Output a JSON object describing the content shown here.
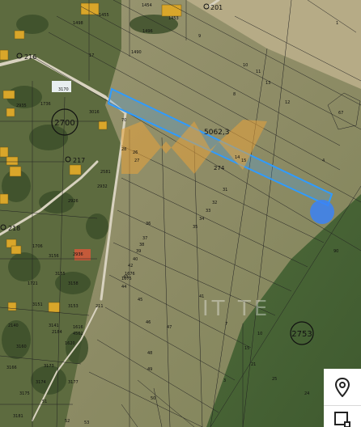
{
  "map": {
    "plot_area_label": "5062,3",
    "highlight_color": "#2f9bff",
    "watermark_text": "IT  TE",
    "road_nodes": [
      "216",
      "201",
      "217",
      "218"
    ],
    "circled_sheets": [
      "2700",
      "2753"
    ],
    "parcel_numbers": {
      "top": [
        "1455",
        "1454",
        "1453",
        "1498",
        "1496",
        "1490",
        "9",
        "17",
        "10",
        "11",
        "8",
        "13",
        "12",
        "67",
        "4",
        "1"
      ],
      "left": [
        "3170",
        "1736",
        "2935",
        "3016",
        "2932",
        "2581",
        "2926",
        "1706",
        "3156",
        "3155",
        "3158",
        "3153",
        "2936",
        "3151",
        "1721",
        "3141",
        "1620",
        "1616",
        "4562",
        "3160",
        "3173",
        "3175",
        "3166",
        "3174",
        "2184",
        "2140",
        "3181",
        "51",
        "3177"
      ],
      "field": [
        "70",
        "27",
        "26",
        "28",
        "31",
        "32",
        "33",
        "34",
        "35",
        "36",
        "37",
        "38",
        "39",
        "40",
        "41",
        "42",
        "43",
        "44",
        "45",
        "46",
        "47",
        "48",
        "49",
        "50",
        "52",
        "53",
        "211",
        "1675",
        "274",
        "1676",
        "14",
        "15"
      ],
      "lower_right": [
        "7",
        "10",
        "15",
        "21",
        "24",
        "25",
        "90",
        "3"
      ]
    }
  },
  "controls": {
    "location_icon": "map-pin-icon",
    "draw_icon": "draw-area-icon"
  }
}
